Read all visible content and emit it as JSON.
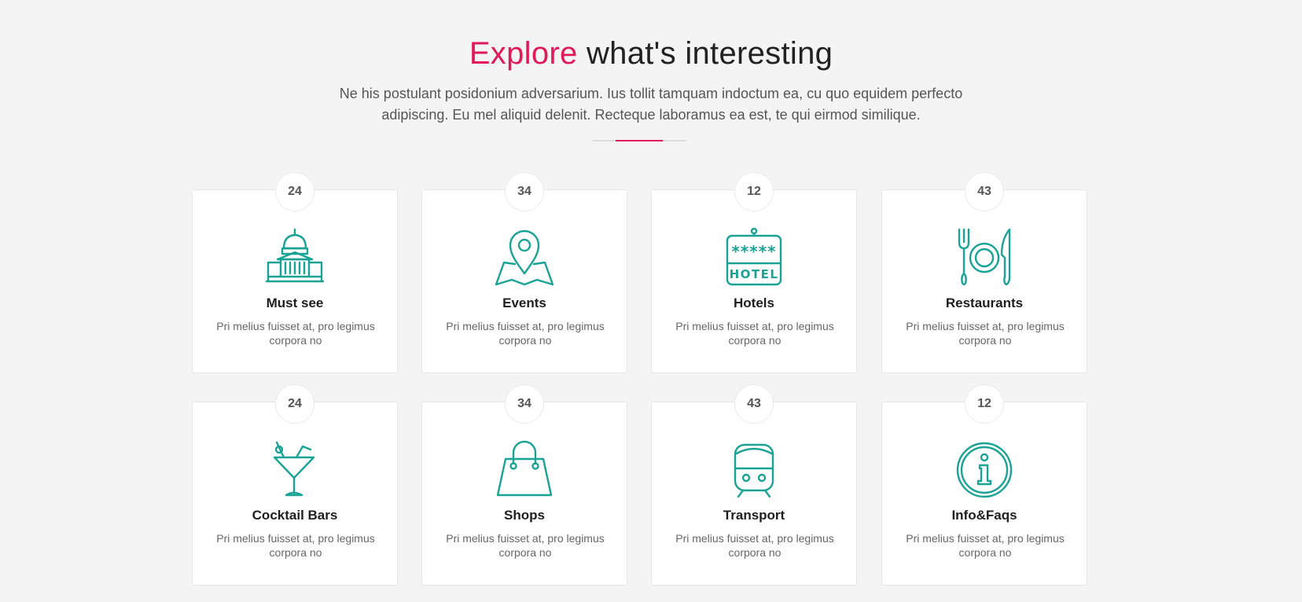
{
  "header": {
    "title_accent": "Explore",
    "title_rest": " what's interesting",
    "subtitle": "Ne his postulant posidonium adversarium. Ius tollit tamquam indoctum ea, cu quo equidem perfecto adipiscing. Eu mel aliquid delenit. Recteque laboramus ea est, te qui eirmod similique."
  },
  "colors": {
    "accent": "#e0195a",
    "icon": "#1aa394"
  },
  "cards": [
    {
      "count": "24",
      "title": "Must see",
      "text": "Pri melius fuisset at, pro legimus corpora no",
      "icon": "monument-icon"
    },
    {
      "count": "34",
      "title": "Events",
      "text": "Pri melius fuisset at, pro legimus corpora no",
      "icon": "map-pin-icon"
    },
    {
      "count": "12",
      "title": "Hotels",
      "text": "Pri melius fuisset at, pro legimus corpora no",
      "icon": "hotel-sign-icon"
    },
    {
      "count": "43",
      "title": "Restaurants",
      "text": "Pri melius fuisset at, pro legimus corpora no",
      "icon": "cutlery-icon"
    },
    {
      "count": "24",
      "title": "Cocktail Bars",
      "text": "Pri melius fuisset at, pro legimus corpora no",
      "icon": "cocktail-icon"
    },
    {
      "count": "34",
      "title": "Shops",
      "text": "Pri melius fuisset at, pro legimus corpora no",
      "icon": "shopping-bag-icon"
    },
    {
      "count": "43",
      "title": "Transport",
      "text": "Pri melius fuisset at, pro legimus corpora no",
      "icon": "train-icon"
    },
    {
      "count": "12",
      "title": "Info&Faqs",
      "text": "Pri melius fuisset at, pro legimus corpora no",
      "icon": "info-icon"
    }
  ],
  "hotel_icon_label": "HOTEL"
}
